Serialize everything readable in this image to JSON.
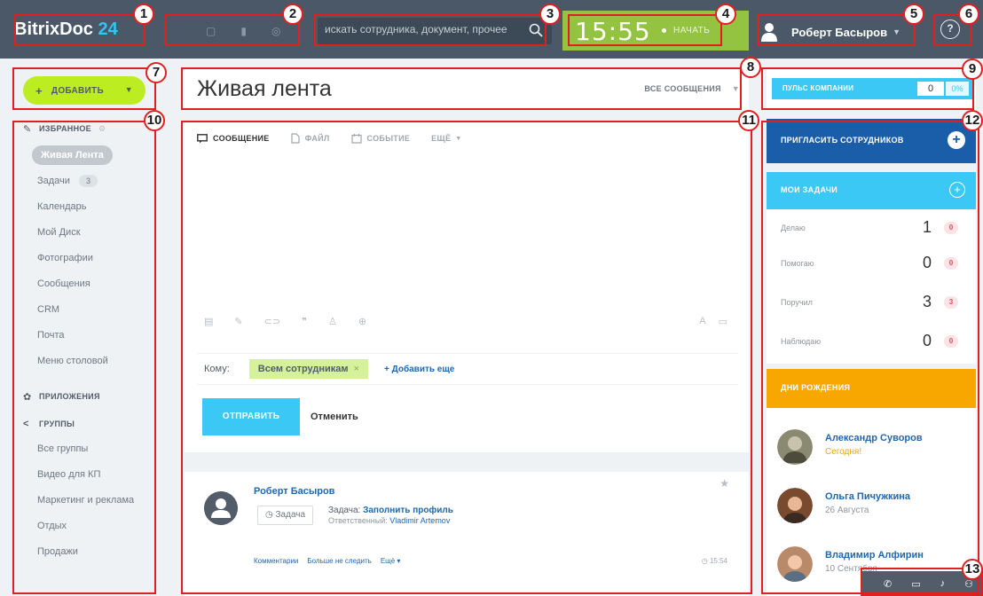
{
  "header": {
    "logo_text": "BitrixDoc",
    "logo_num": "24",
    "search_placeholder": "искать сотрудника, документ, прочее",
    "clock_time": "15:55",
    "clock_action": "НАЧАТЬ",
    "user_name": "Роберт Басыров",
    "help_icon": "?"
  },
  "sidebar": {
    "add_button": "ДОБАВИТЬ",
    "favorites_label": "ИЗБРАННОЕ",
    "favorites": [
      {
        "label": "Живая Лента"
      },
      {
        "label": "Задачи",
        "badge": "3"
      },
      {
        "label": "Календарь"
      },
      {
        "label": "Мой Диск"
      },
      {
        "label": "Фотографии"
      },
      {
        "label": "Сообщения"
      },
      {
        "label": "CRM"
      },
      {
        "label": "Почта"
      },
      {
        "label": "Меню столовой"
      }
    ],
    "apps_label": "ПРИЛОЖЕНИЯ",
    "groups_label": "ГРУППЫ",
    "groups": [
      {
        "label": "Все группы"
      },
      {
        "label": "Видео для КП"
      },
      {
        "label": "Маркетинг и реклама"
      },
      {
        "label": "Отдых"
      },
      {
        "label": "Продажи"
      }
    ]
  },
  "main": {
    "title": "Живая лента",
    "filter": "ВСЕ СООБЩЕНИЯ",
    "tabs": [
      {
        "label": "СООБЩЕНИЕ"
      },
      {
        "label": "ФАЙЛ"
      },
      {
        "label": "СОБЫТИЕ"
      },
      {
        "label": "ЕЩЁ"
      }
    ],
    "to_label": "Кому:",
    "recipient": "Всем сотрудникам",
    "add_more": "+ Добавить еще",
    "send": "ОТПРАВИТЬ",
    "cancel": "Отменить"
  },
  "feed_item": {
    "author": "Роберт Басыров",
    "tag": "Задача",
    "task_prefix": "Задача:",
    "task_title": "Заполнить профиль",
    "responsible_label": "Ответственный:",
    "responsible_name": "Vladimir Artemov",
    "actions": [
      "Комментарии",
      "Больше не следить",
      "Ещё ▾"
    ],
    "time": "15:54"
  },
  "right": {
    "pulse_label": "ПУЛЬС КОМПАНИИ",
    "pulse_value": "0",
    "pulse_pct": "0%",
    "invite_label": "ПРИГЛАСИТЬ СОТРУДНИКОВ",
    "tasks_label": "МОИ ЗАДАЧИ",
    "tasks": [
      {
        "name": "Делаю",
        "count": "1",
        "badge": "0"
      },
      {
        "name": "Помогаю",
        "count": "0",
        "badge": "0"
      },
      {
        "name": "Поручил",
        "count": "3",
        "badge": "3"
      },
      {
        "name": "Наблюдаю",
        "count": "0",
        "badge": "0"
      }
    ],
    "bdays_label": "ДНИ РОЖДЕНИЯ",
    "birthdays": [
      {
        "name": "Александр Суворов",
        "date": "Сегодня!"
      },
      {
        "name": "Ольга Пичужкина",
        "date": "26 Августа"
      },
      {
        "name": "Владимир Алфирин",
        "date": "10 Сентября"
      }
    ]
  },
  "annotations": [
    "1",
    "2",
    "3",
    "4",
    "5",
    "6",
    "7",
    "8",
    "9",
    "10",
    "11",
    "12",
    "13"
  ],
  "colors": {
    "header": "#4a5868",
    "clock": "#93c341",
    "add_button": "#bbed21",
    "accent": "#3bc8f5",
    "invite": "#1a5da8",
    "birthdays": "#f7a700",
    "annotation": "#e02020"
  }
}
